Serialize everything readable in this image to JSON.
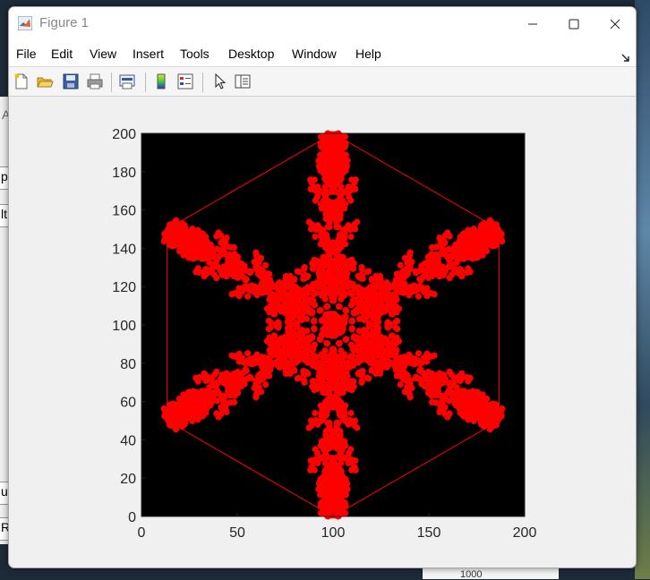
{
  "window": {
    "title": "Figure 1"
  },
  "menu": [
    "File",
    "Edit",
    "View",
    "Insert",
    "Tools",
    "Desktop",
    "Window",
    "Help"
  ],
  "toolbar": [
    "new-figure-icon",
    "open-folder-icon",
    "save-icon",
    "print-icon",
    "print-preview-icon",
    "colorbar-icon",
    "legend-icon",
    "pointer-icon",
    "property-editor-icon"
  ],
  "background_fragments": [
    "A",
    "p",
    "lt",
    "ur",
    "R",
    "1000"
  ],
  "colors": {
    "plot_bg": "#000000",
    "shape": "#ff0000",
    "hexagon": "#ff0000"
  },
  "chart_data": {
    "type": "scatter",
    "title": "",
    "xlabel": "",
    "ylabel": "",
    "xlim": [
      0,
      200
    ],
    "ylim": [
      0,
      200
    ],
    "xticks": [
      0,
      50,
      100,
      150,
      200
    ],
    "yticks": [
      0,
      20,
      40,
      60,
      80,
      100,
      120,
      140,
      160,
      180,
      200
    ],
    "grid": false,
    "hexagon_vertices": [
      [
        100,
        200
      ],
      [
        186.6,
        150
      ],
      [
        186.6,
        50
      ],
      [
        100,
        0
      ],
      [
        13.4,
        50
      ],
      [
        13.4,
        150
      ]
    ],
    "center": [
      100,
      100
    ],
    "description_points": "dense red fractal snowflake point cloud with six-fold symmetry centered at (100,100), arms reaching each hexagon vertex"
  }
}
